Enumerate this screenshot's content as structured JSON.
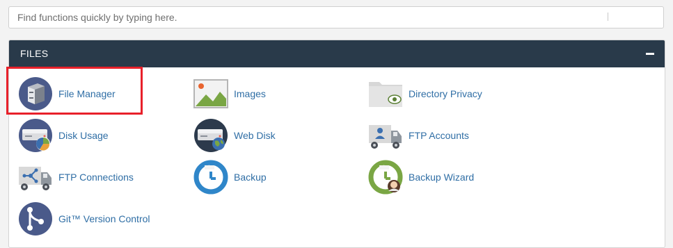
{
  "search": {
    "placeholder": "Find functions quickly by typing here."
  },
  "section": {
    "title": "FILES",
    "items": [
      {
        "label": "File Manager",
        "icon": "file-manager-icon"
      },
      {
        "label": "Images",
        "icon": "images-icon"
      },
      {
        "label": "Directory Privacy",
        "icon": "directory-privacy-icon"
      },
      {
        "label": "Disk Usage",
        "icon": "disk-usage-icon"
      },
      {
        "label": "Web Disk",
        "icon": "web-disk-icon"
      },
      {
        "label": "FTP Accounts",
        "icon": "ftp-accounts-icon"
      },
      {
        "label": "FTP Connections",
        "icon": "ftp-connections-icon"
      },
      {
        "label": "Backup",
        "icon": "backup-icon"
      },
      {
        "label": "Backup Wizard",
        "icon": "backup-wizard-icon"
      },
      {
        "label": "Git™ Version Control",
        "icon": "git-version-control-icon"
      }
    ]
  },
  "colors": {
    "header_bg": "#293a4a",
    "link": "#2f6ea5",
    "highlight": "#e8202a"
  }
}
